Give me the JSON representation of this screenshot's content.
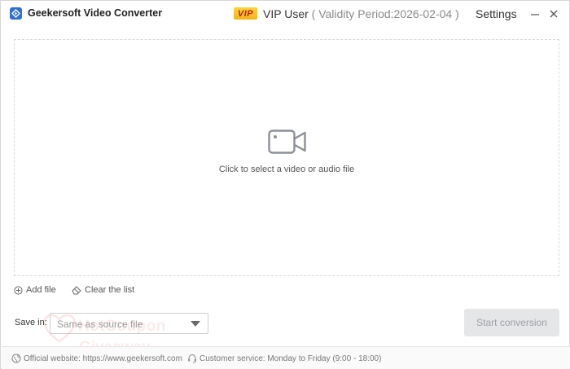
{
  "app": {
    "title": "Geekersoft Video Converter"
  },
  "header": {
    "vip_badge": "VIP",
    "vip_user": "VIP User",
    "vip_validity": " ( Validity Period:2026-02-04 )",
    "settings_label": "Settings",
    "minimize_glyph": "—",
    "close_glyph": "✕"
  },
  "dropzone": {
    "hint": "Click to select a video or audio file",
    "icon": "video-camera-icon"
  },
  "list_actions": {
    "add_file": "Add file",
    "clear_list": "Clear the list"
  },
  "output": {
    "save_in_label": "Save in:",
    "save_in_value": "Same as source file",
    "start_label": "Start conversion"
  },
  "footer": {
    "website": "Official website: https://www.geekersoft.com",
    "service": "Customer service: Monday to Friday (9:00 - 18:00)"
  },
  "watermark": {
    "line1": "HotCoupon",
    "line2": "Giveaway"
  },
  "colors": {
    "accent": "#2f6fd6",
    "vip_gold": "#f7b21b",
    "disabled_button": "#e5e6e8"
  }
}
